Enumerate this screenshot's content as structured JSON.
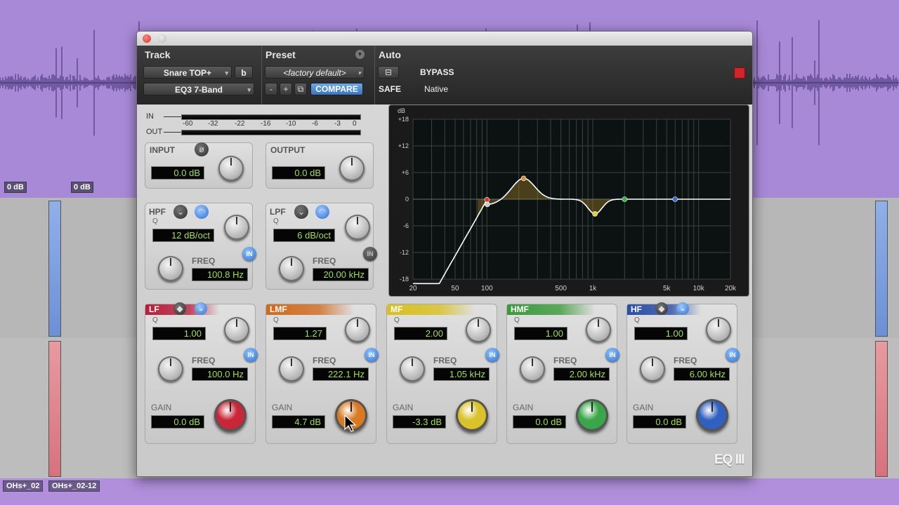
{
  "daw": {
    "vol_labels": [
      "0 dB",
      "0 dB"
    ],
    "clip_labels": [
      "OHs+_02",
      "OHs+_02-12"
    ]
  },
  "header": {
    "track_label": "Track",
    "preset_label": "Preset",
    "auto_label": "Auto",
    "track_name": "Snare TOP+",
    "track_channel": "b",
    "plugin_name": "EQ3 7-Band",
    "preset_name": "<factory default>",
    "minus": "-",
    "plus": "+",
    "compare": "COMPARE",
    "safe": "SAFE",
    "bypass": "BYPASS",
    "native": "Native"
  },
  "meters": {
    "in_label": "IN",
    "out_label": "OUT",
    "scale": [
      "-60",
      "-32",
      "-22",
      "-16",
      "-10",
      "-6",
      "-3",
      "0"
    ]
  },
  "input": {
    "label": "INPUT",
    "value": "0.0 dB",
    "phase_icon": "phase-invert-icon"
  },
  "output": {
    "label": "OUTPUT",
    "value": "0.0 dB"
  },
  "hpf": {
    "label": "HPF",
    "q_label": "Q",
    "slope": "12 dB/oct",
    "freq_label": "FREQ",
    "freq": "100.8 Hz",
    "in": "IN"
  },
  "lpf": {
    "label": "LPF",
    "q_label": "Q",
    "slope": "6 dB/oct",
    "freq_label": "FREQ",
    "freq": "20.00 kHz",
    "in": "IN"
  },
  "bands": [
    {
      "label": "LF",
      "q": "1.00",
      "freq": "100.0 Hz",
      "gain": "0.0 dB",
      "color": "#b8203a",
      "knob": "#c92638"
    },
    {
      "label": "LMF",
      "q": "1.27",
      "freq": "222.1 Hz",
      "gain": "4.7 dB",
      "color": "#d06a1c",
      "knob": "#d97a22"
    },
    {
      "label": "MF",
      "q": "2.00",
      "freq": "1.05 kHz",
      "gain": "-3.3 dB",
      "color": "#d8c020",
      "knob": "#d9c22a"
    },
    {
      "label": "HMF",
      "q": "1.00",
      "freq": "2.00 kHz",
      "gain": "0.0 dB",
      "color": "#3a9a3a",
      "knob": "#3aa64a"
    },
    {
      "label": "HF",
      "q": "1.00",
      "freq": "6.00 kHz",
      "gain": "0.0 dB",
      "color": "#2b4ea8",
      "knob": "#3060c0"
    }
  ],
  "common": {
    "q_label": "Q",
    "freq_label": "FREQ",
    "gain_label": "GAIN",
    "in": "IN"
  },
  "graph": {
    "db_label": "dB",
    "y_ticks": [
      "+18",
      "+12",
      "+6",
      "0",
      "-6",
      "-12",
      "-18"
    ],
    "x_ticks": [
      "20",
      "50",
      "100",
      "500",
      "1k",
      "5k",
      "10k",
      "20k"
    ]
  },
  "logo": "EQ III"
}
